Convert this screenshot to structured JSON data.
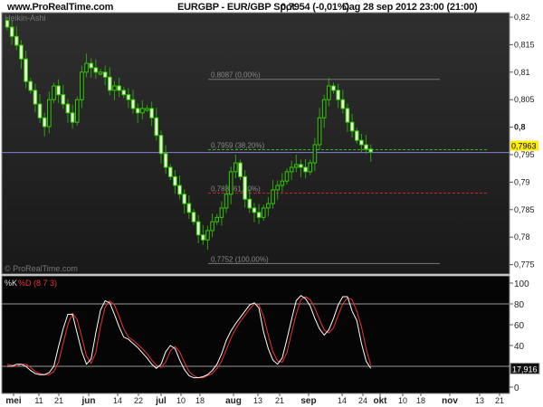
{
  "header": {
    "site": "www.ProRealTime.com",
    "instrument": "EURGBP - EUR/GBP Spot",
    "quote": "0,7954 (-0,01%)",
    "period": "Dag  28 sep 2012 23:00 (21:00)"
  },
  "colors": {
    "up_border": "#33cc00",
    "down_fill": "#e8ffd8",
    "fib_gray": "#777777",
    "fib_green": "#22bb22",
    "fib_red": "#cc2222",
    "price_line": "#7777bb",
    "last_price_bg": "#ffee00",
    "stoch_k": "#ffffff",
    "stoch_d": "#ee3333"
  },
  "chart_data": [
    {
      "type": "candlestick",
      "style": "Heikin-Ashi",
      "label": "Heikin-Ashi",
      "watermark": "© ProRealTime.com",
      "ylim": [
        0.7735,
        0.8225
      ],
      "yticks": [
        "0,82",
        "0,815",
        "0,81",
        "0,805",
        "0,8",
        "0,795",
        "0,79",
        "0,785",
        "0,78",
        "0,775"
      ],
      "ytick_values": [
        0.82,
        0.815,
        0.81,
        0.805,
        0.8,
        0.795,
        0.79,
        0.785,
        0.78,
        0.775
      ],
      "last_price": 0.7954,
      "last_price_label": "0,7963",
      "closes": [
        0.8182,
        0.8165,
        0.8149,
        0.8124,
        0.8083,
        0.8067,
        0.8042,
        0.8017,
        0.8001,
        0.805,
        0.8075,
        0.8059,
        0.8042,
        0.8026,
        0.8009,
        0.805,
        0.81,
        0.8116,
        0.8108,
        0.81,
        0.81,
        0.8091,
        0.8067,
        0.8075,
        0.8067,
        0.8059,
        0.805,
        0.8034,
        0.8026,
        0.8034,
        0.8034,
        0.8017,
        0.7985,
        0.7952,
        0.7927,
        0.791,
        0.7894,
        0.7878,
        0.7861,
        0.7845,
        0.7828,
        0.7804,
        0.7795,
        0.7812,
        0.7828,
        0.7836,
        0.7853,
        0.7878,
        0.7919,
        0.7935,
        0.791,
        0.7869,
        0.7853,
        0.7845,
        0.7836,
        0.7853,
        0.7861,
        0.7886,
        0.7894,
        0.7902,
        0.7919,
        0.7927,
        0.7932,
        0.7927,
        0.7919,
        0.7935,
        0.7968,
        0.8017,
        0.805,
        0.8075,
        0.8067,
        0.805,
        0.8034,
        0.8009,
        0.7993,
        0.7976,
        0.7968,
        0.796,
        0.7955
      ],
      "fibonacci": [
        {
          "value": 0.8087,
          "label": "0,8087 (0,00%)",
          "color": "gray"
        },
        {
          "value": 0.7959,
          "label": "0,7959 (38,20%)",
          "color": "green"
        },
        {
          "value": 0.788,
          "label": "0,788 (61,80%)",
          "color": "red"
        },
        {
          "value": 0.7752,
          "label": "0,7752 (100,00%)",
          "color": "gray"
        }
      ]
    },
    {
      "type": "line",
      "title_k": "%K",
      "title_d": "%D (8 7 3)",
      "ylim": [
        0,
        100
      ],
      "yticks": [
        "100",
        "80",
        "60",
        "40",
        "0"
      ],
      "ytick_values": [
        100,
        80,
        60,
        40,
        0
      ],
      "levels": [
        80,
        20
      ],
      "last_value_label": "17,916",
      "series": [
        {
          "name": "%K",
          "values": [
            20,
            20,
            22,
            22,
            20,
            16,
            13,
            12,
            12,
            14,
            20,
            39,
            56,
            70,
            70,
            52,
            34,
            22,
            27,
            52,
            74,
            83,
            81,
            70,
            58,
            48,
            46,
            42,
            38,
            33,
            28,
            22,
            18,
            22,
            34,
            40,
            37,
            26,
            17,
            11,
            9,
            9,
            10,
            12,
            16,
            22,
            32,
            45,
            54,
            61,
            67,
            73,
            79,
            81,
            76,
            53,
            37,
            26,
            22,
            28,
            46,
            65,
            83,
            88,
            85,
            78,
            66,
            56,
            50,
            55,
            66,
            79,
            87,
            87,
            73,
            64,
            42,
            25,
            17.9
          ]
        },
        {
          "name": "%D",
          "values": [
            22,
            21,
            20,
            22,
            22,
            19,
            15,
            13,
            12,
            12,
            15,
            24,
            42,
            60,
            71,
            65,
            48,
            30,
            23,
            33,
            58,
            77,
            83,
            79,
            68,
            56,
            48,
            45,
            41,
            37,
            32,
            26,
            21,
            19,
            24,
            35,
            39,
            34,
            24,
            15,
            11,
            9,
            9,
            11,
            13,
            18,
            25,
            36,
            47,
            56,
            63,
            69,
            75,
            80,
            79,
            68,
            50,
            34,
            25,
            24,
            33,
            52,
            70,
            84,
            87,
            84,
            76,
            65,
            55,
            52,
            57,
            69,
            80,
            86,
            84,
            73,
            58,
            37,
            21
          ]
        }
      ]
    }
  ],
  "xaxis": {
    "labels": [
      {
        "text": "mei",
        "bold": true
      },
      {
        "text": "11"
      },
      {
        "text": "21"
      },
      {
        "text": "jun",
        "bold": true
      },
      {
        "text": "14"
      },
      {
        "text": "22"
      },
      {
        "text": "jul",
        "bold": true
      },
      {
        "text": "10"
      },
      {
        "text": "18"
      },
      {
        "text": "aug",
        "bold": true
      },
      {
        "text": "13"
      },
      {
        "text": "21"
      },
      {
        "text": "sep",
        "bold": true
      },
      {
        "text": "14"
      },
      {
        "text": "24"
      },
      {
        "text": "okt",
        "bold": true
      },
      {
        "text": "10"
      },
      {
        "text": "18"
      },
      {
        "text": "nov",
        "bold": true
      },
      {
        "text": "13"
      },
      {
        "text": "21"
      }
    ]
  }
}
